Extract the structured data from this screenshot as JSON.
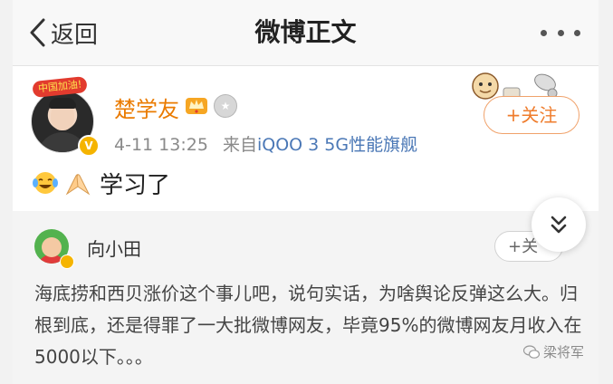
{
  "header": {
    "back_label": "返回",
    "title": "微博正文",
    "more_icon": "more-icon"
  },
  "post": {
    "avatar_banner": "中国加油!",
    "username": "楚学友",
    "time": "4-11 13:25",
    "source_prefix": "来自",
    "device": "iQOO 3 5G性能旗舰",
    "follow_label": "+关注",
    "emojis": [
      "crying-laughing-emoji",
      "praying-hands-emoji"
    ],
    "content": "学习了"
  },
  "repost": {
    "username": "向小田",
    "follow_label": "+关",
    "text": "海底捞和西贝涨价这个事儿吧，说句实话，为啥舆论反弹这么大。归根到底，还是得罪了一大批微博网友，毕竟95%的微博网友月收入在5000以下。。。"
  },
  "watermark": "梁将军",
  "colors": {
    "username": "#ea7b00",
    "follow": "#ef7c2c",
    "device_link": "#4b78b6",
    "repost_bg": "#f4f4f4"
  }
}
